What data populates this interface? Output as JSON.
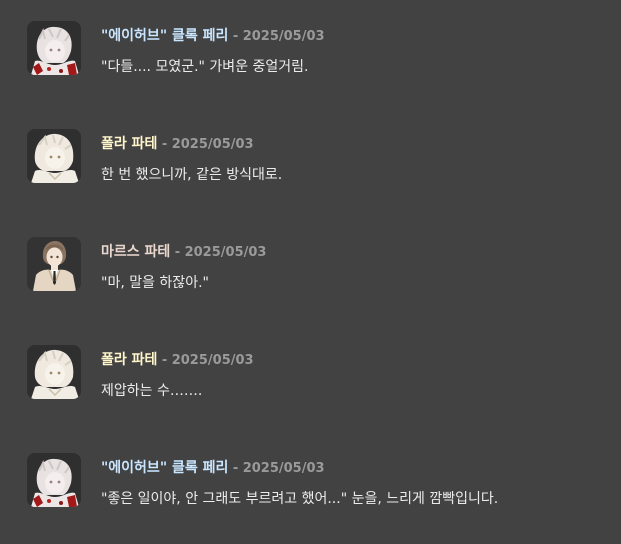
{
  "messages": [
    {
      "avatar_icon": "white-haired-character-red-accent-avatar",
      "name": "\"에이허브\" 클록 페리",
      "name_color": "#c9e6ff",
      "separator": "-",
      "date": "2025/05/03",
      "text": "\"다들.... 모였군.\" 가벼운 중얼거림."
    },
    {
      "avatar_icon": "light-haired-character-avatar",
      "name": "폴라 파테",
      "name_color": "#fff6cc",
      "separator": "-",
      "date": "2025/05/03",
      "text": "한 번 했으니까, 같은 방식대로."
    },
    {
      "avatar_icon": "suited-character-avatar",
      "name": "마르스 파테",
      "name_color": "#ead8cf",
      "separator": "-",
      "date": "2025/05/03",
      "text": "\"마, 말을 하잖아.\""
    },
    {
      "avatar_icon": "light-haired-character-avatar",
      "name": "폴라 파테",
      "name_color": "#fff6cc",
      "separator": "-",
      "date": "2025/05/03",
      "text": "제압하는 수……."
    },
    {
      "avatar_icon": "white-haired-character-red-accent-avatar",
      "name": "\"에이허브\" 클록 페리",
      "name_color": "#c9e6ff",
      "separator": "-",
      "date": "2025/05/03",
      "text": "\"좋은 일이야, 안 그래도 부르려고 했어...\" 눈을, 느리게 깜빡입니다."
    }
  ]
}
